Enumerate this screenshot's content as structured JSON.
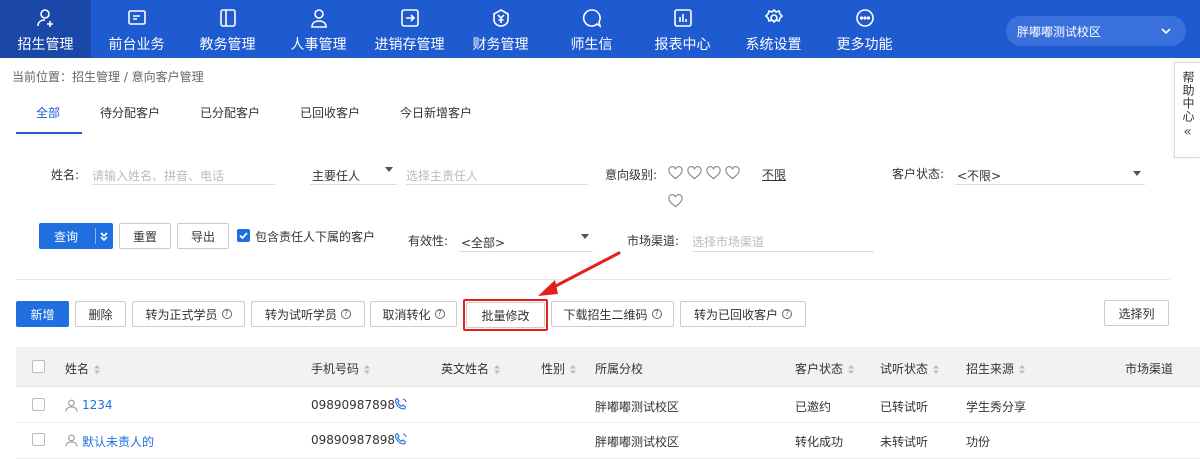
{
  "nav": {
    "items": [
      {
        "label": "招生管理",
        "icon": "person-plus-icon",
        "active": true
      },
      {
        "label": "前台业务",
        "icon": "monitor-icon"
      },
      {
        "label": "教务管理",
        "icon": "book-icon"
      },
      {
        "label": "人事管理",
        "icon": "person-icon"
      },
      {
        "label": "进销存管理",
        "icon": "login-box-icon"
      },
      {
        "label": "财务管理",
        "icon": "yen-shield-icon"
      },
      {
        "label": "师生信",
        "icon": "chat-bubble-icon"
      },
      {
        "label": "报表中心",
        "icon": "chart-icon"
      },
      {
        "label": "系统设置",
        "icon": "gear-icon"
      },
      {
        "label": "更多功能",
        "icon": "more-circle-icon"
      }
    ],
    "campus": "胖嘟嘟测试校区"
  },
  "breadcrumb": "当前位置：招生管理 / 意向客户管理",
  "help": {
    "label": "帮助中心",
    "collapse": "«"
  },
  "tabs": [
    "全部",
    "待分配客户",
    "已分配客户",
    "已回收客户",
    "今日新增客户"
  ],
  "filters": {
    "name_label": "姓名:",
    "name_placeholder": "请输入姓名、拼音、电话",
    "owner_select": "主要任人",
    "owner_placeholder": "选择主责任人",
    "level_label": "意向级别:",
    "level_unlimited": "不限",
    "status_label": "客户状态:",
    "status_value": "<不限>",
    "validity_label": "有效性:",
    "validity_value": "<全部>",
    "channel_label": "市场渠道:",
    "channel_placeholder": "选择市场渠道",
    "query": "查询",
    "reset": "重置",
    "export": "导出",
    "include_sub": "包含责任人下属的客户"
  },
  "actions": {
    "add": "新增",
    "delete": "删除",
    "to_formal": "转为正式学员",
    "to_trial": "转为试听学员",
    "cancel_convert": "取消转化",
    "batch_edit": "批量修改",
    "download_qr": "下载招生二维码",
    "to_recycled": "转为已回收客户",
    "select_columns": "选择列"
  },
  "table": {
    "headers": {
      "name": "姓名",
      "phone": "手机号码",
      "en_name": "英文姓名",
      "gender": "性别",
      "campus": "所属分校",
      "cust_status": "客户状态",
      "trial_status": "试听状态",
      "source": "招生来源",
      "channel": "市场渠道"
    },
    "rows": [
      {
        "name": "1234",
        "phone": "09890987898",
        "campus": "胖嘟嘟测试校区",
        "cust_status": "已邀约",
        "trial_status": "已转试听",
        "source": "学生秀分享"
      },
      {
        "name": "默认未责人的",
        "phone": "09890987898",
        "campus": "胖嘟嘟测试校区",
        "cust_status": "转化成功",
        "trial_status": "未转试听",
        "source": "功份"
      }
    ]
  },
  "colors": {
    "brand": "#1f5bd0",
    "primary_button": "#1f6fe0",
    "highlight": "#e3201b"
  }
}
